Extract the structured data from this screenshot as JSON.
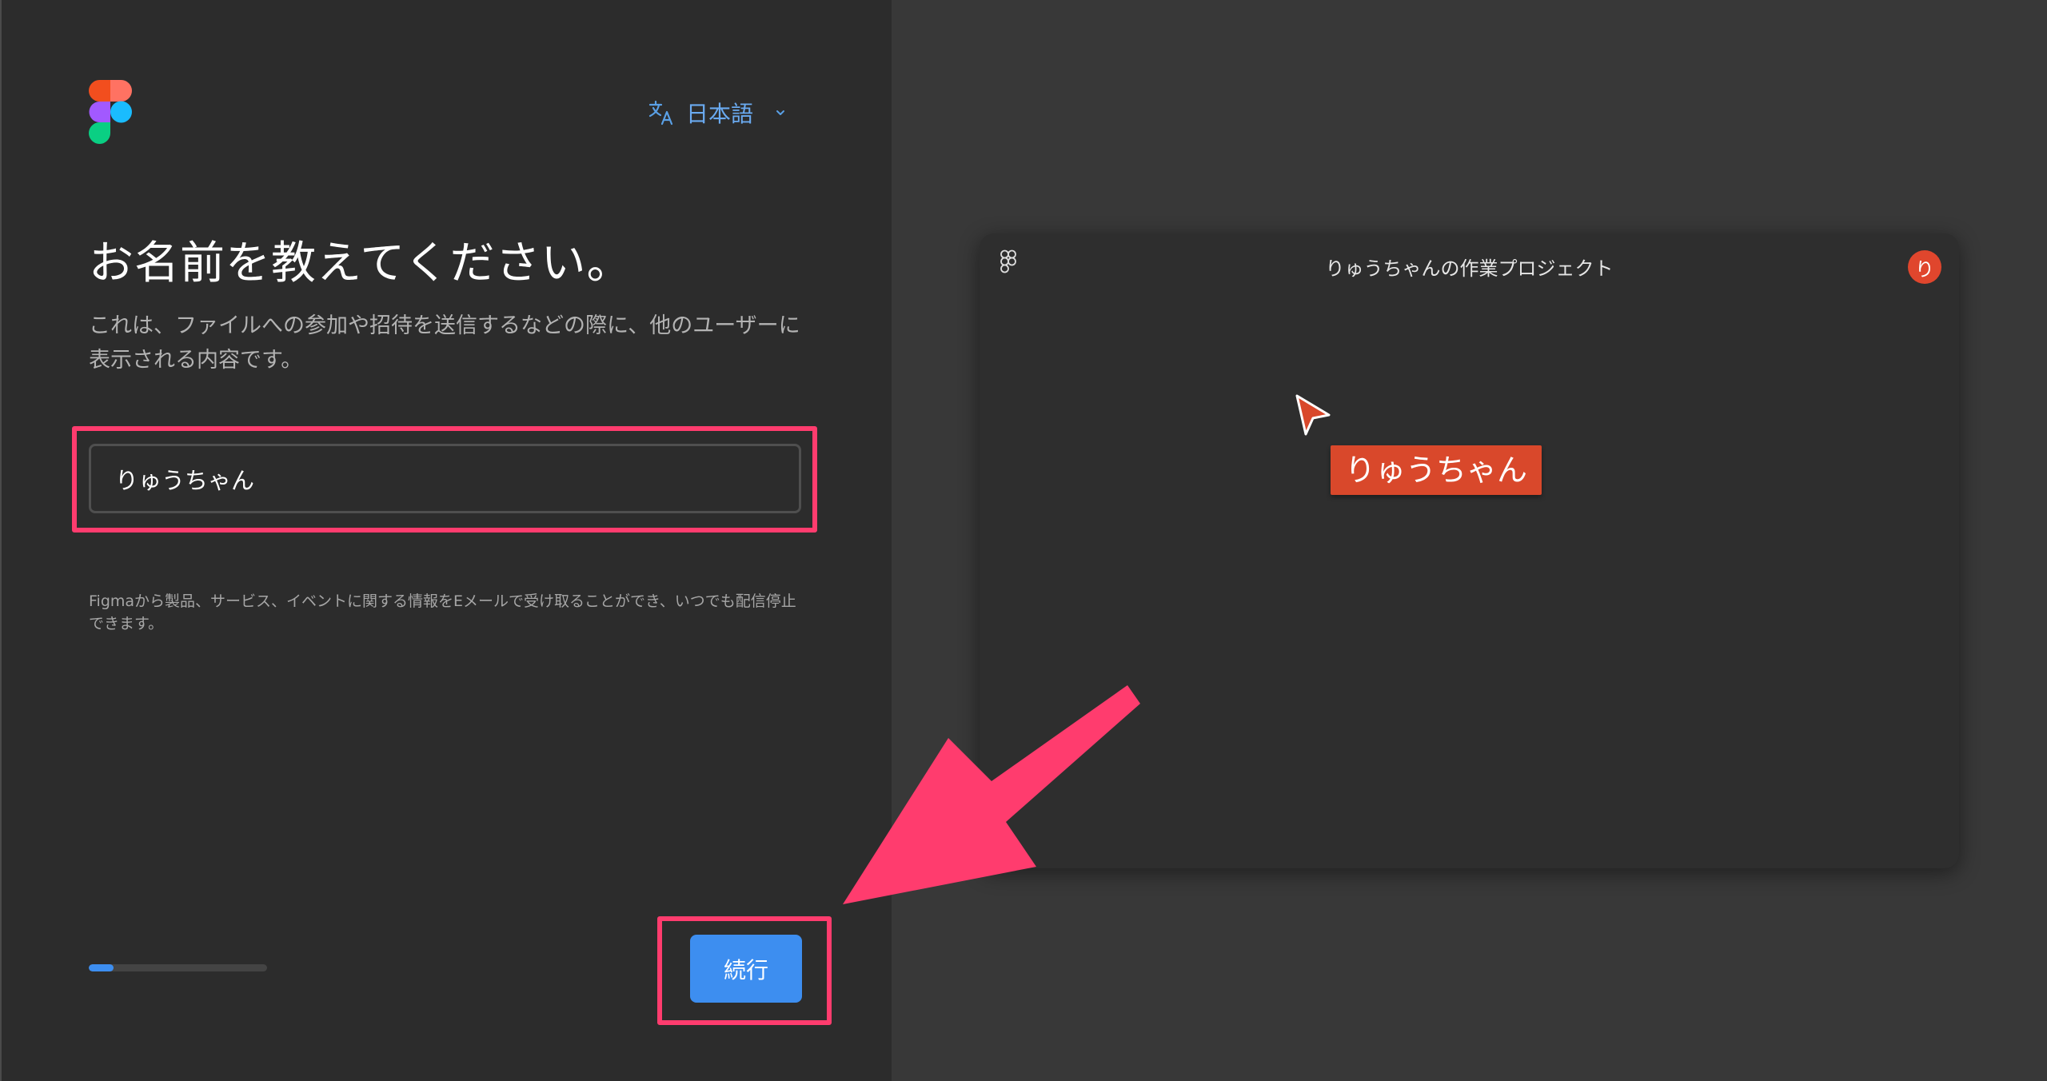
{
  "language": {
    "label": "日本語"
  },
  "onboarding": {
    "title": "お名前を教えてください。",
    "description": "これは、ファイルへの参加や招待を送信するなどの際に、他のユーザーに表示される内容です。",
    "name_value": "りゅうちゃん",
    "legal": "Figmaから製品、サービス、イベントに関する情報をEメールで受け取ることができ、いつでも配信停止できます。",
    "continue_label": "続行",
    "progress": 0.14
  },
  "preview": {
    "title": "りゅうちゃんの作業プロジェクト",
    "avatar_initial": "り",
    "cursor_label": "りゅうちゃん"
  },
  "icons": {
    "logo": "figma-logo",
    "language": "translate-icon",
    "chevron": "chevron-down-icon",
    "cursor": "cursor-pointer-icon",
    "annotation": "arrow-annotation"
  },
  "colors": {
    "accent": "#3d8ef0",
    "highlight": "#ff3c6e",
    "avatar": "#e0462d",
    "panel_left": "#2c2c2c",
    "panel_right": "#383838"
  }
}
